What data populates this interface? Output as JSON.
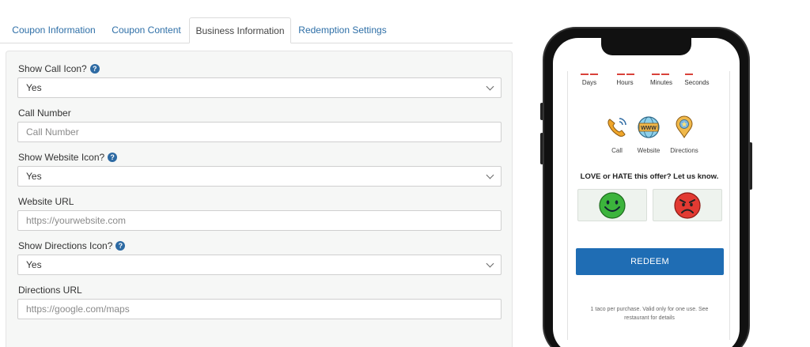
{
  "tabs": [
    {
      "label": "Coupon Information",
      "active": false
    },
    {
      "label": "Coupon Content",
      "active": false
    },
    {
      "label": "Business Information",
      "active": true
    },
    {
      "label": "Redemption Settings",
      "active": false
    }
  ],
  "form": {
    "show_call_icon": {
      "label": "Show Call Icon?",
      "value": "Yes"
    },
    "call_number": {
      "label": "Call Number",
      "placeholder": "Call Number"
    },
    "show_website_icon": {
      "label": "Show Website Icon?",
      "value": "Yes"
    },
    "website_url": {
      "label": "Website URL",
      "placeholder": "https://yourwebsite.com"
    },
    "show_directions_icon": {
      "label": "Show Directions Icon?",
      "value": "Yes"
    },
    "directions_url": {
      "label": "Directions URL",
      "placeholder": "https://google.com/maps"
    },
    "help_glyph": "?"
  },
  "preview": {
    "countdown_labels": [
      "Days",
      "Hours",
      "Minutes",
      "Seconds"
    ],
    "contact": [
      {
        "label": "Call",
        "icon": "phone-icon"
      },
      {
        "label": "Website",
        "icon": "globe-icon",
        "icon_text": "WWW"
      },
      {
        "label": "Directions",
        "icon": "map-pin-icon"
      }
    ],
    "feedback_title": "LOVE or HATE this offer? Let us know.",
    "redeem_label": "REDEEM",
    "fine_print": "1 taco per purchase. Valid only for one use. See restaurant for details"
  },
  "colors": {
    "link": "#2e6fa7",
    "help_icon": "#2d6aa3",
    "redeem": "#1f6db4",
    "countdown_accent": "#d9423a",
    "happy": "#3cb43c",
    "angry": "#e23a32"
  }
}
